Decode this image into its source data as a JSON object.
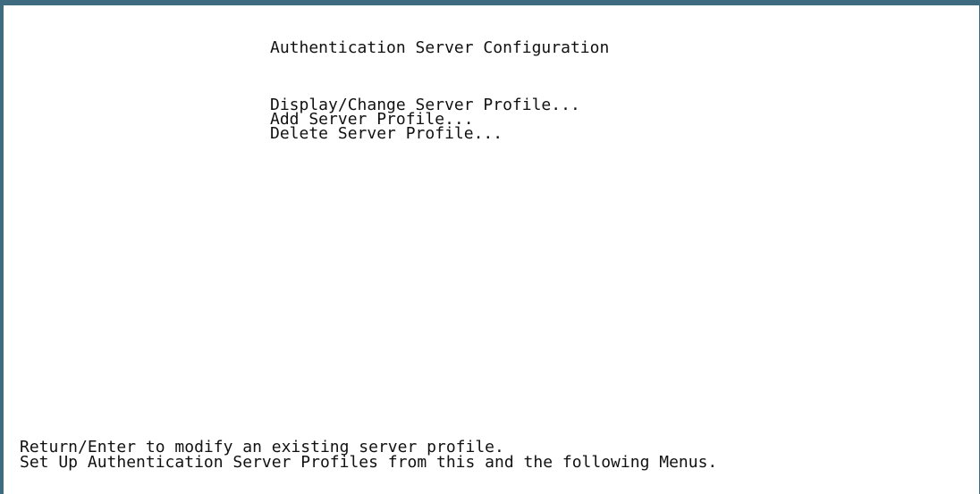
{
  "screen": {
    "title": "Authentication Server Configuration",
    "menu_items": [
      "Display/Change Server Profile...",
      "Add Server Profile...",
      "Delete Server Profile..."
    ],
    "status_lines": [
      "Return/Enter to modify an existing server profile.",
      "Set Up Authentication Server Profiles from this and the following Menus."
    ],
    "border_color": "#3f6b80",
    "background_color": "#ffffff",
    "text_color": "#111111"
  }
}
